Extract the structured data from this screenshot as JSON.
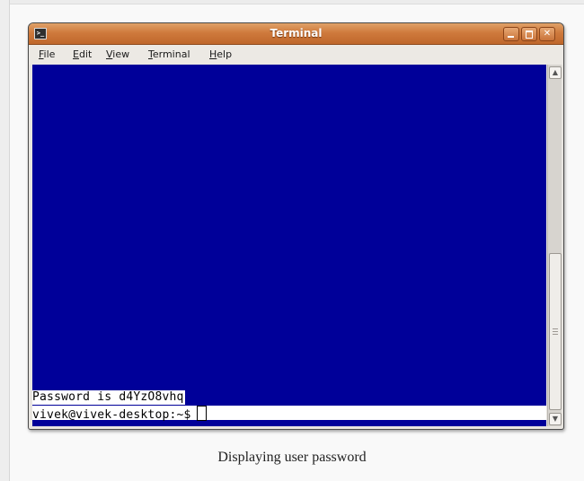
{
  "window": {
    "title": "Terminal",
    "app_icon": "terminal-icon",
    "controls": {
      "minimize": "minimize-icon",
      "maximize": "maximize-icon",
      "close": "close-icon",
      "close_glyph": "✕"
    }
  },
  "menubar": {
    "items": [
      {
        "label": "File",
        "mnemonic": "F",
        "rest": "ile"
      },
      {
        "label": "Edit",
        "mnemonic": "E",
        "rest": "dit"
      },
      {
        "label": "View",
        "mnemonic": "V",
        "rest": "iew"
      },
      {
        "label": "Terminal",
        "mnemonic": "T",
        "rest": "erminal"
      },
      {
        "label": "Help",
        "mnemonic": "H",
        "rest": "elp"
      }
    ]
  },
  "terminal": {
    "background": "#000099",
    "lines": [
      "Password is d4YzO8vhq",
      "vivek@vivek-desktop:~$"
    ]
  },
  "scrollbar": {
    "up_glyph": "▲",
    "down_glyph": "▼"
  },
  "caption": "Displaying user password",
  "colors": {
    "titlebar": "#cf7a3d",
    "menubar": "#ece9e4",
    "terminal_bg": "#000099"
  }
}
